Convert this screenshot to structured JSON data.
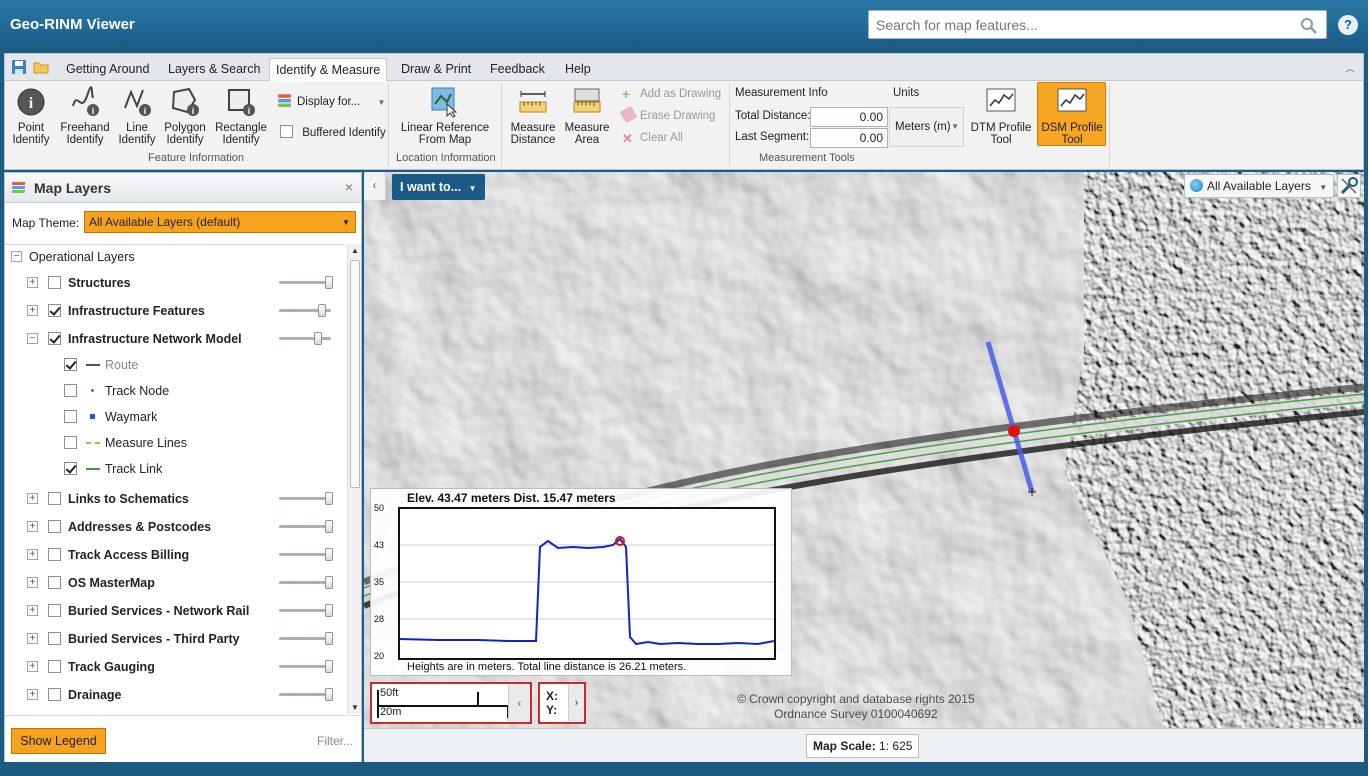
{
  "app": {
    "title": "Geo-RINM Viewer",
    "search_placeholder": "Search for map features...",
    "help_label": "?"
  },
  "ribbon": {
    "tabs": [
      "Getting Around",
      "Layers & Search",
      "Identify & Measure",
      "Draw & Print",
      "Feedback",
      "Help"
    ],
    "active_tab": "Identify & Measure",
    "feature_info": {
      "group_label": "Feature Information",
      "point_identify": "Point Identify",
      "freehand_identify": "Freehand Identify",
      "line_identify": "Line Identify",
      "polygon_identify": "Polygon Identify",
      "rectangle_identify": "Rectangle Identify",
      "display_for": "Display for...",
      "buffered_identify": "Buffered Identify"
    },
    "location_info": {
      "group_label": "Location Information",
      "linear_reference": "Linear Reference From Map"
    },
    "measurement": {
      "group_label": "Measurement Tools",
      "measure_distance": "Measure Distance",
      "measure_area": "Measure Area",
      "add_as_drawing": "Add as Drawing",
      "erase_drawing": "Erase Drawing",
      "clear_all": "Clear All",
      "info_header": "Measurement Info",
      "units_header": "Units",
      "total_distance_label": "Total Distance:",
      "total_distance_value": "0.00",
      "last_segment_label": "Last Segment:",
      "last_segment_value": "0.00",
      "units_value": "Meters (m)",
      "dtm_profile": "DTM Profile Tool",
      "dsm_profile": "DSM Profile Tool"
    }
  },
  "layers_panel": {
    "title": "Map Layers",
    "close_label": "×",
    "theme_label": "Map Theme:",
    "theme_value": "All Available Layers (default)",
    "root_label": "Operational Layers",
    "layers": [
      {
        "label": "Structures",
        "checked": false,
        "slider": 1.0
      },
      {
        "label": "Infrastructure Features",
        "checked": true,
        "slider": 0.85
      },
      {
        "label": "Infrastructure Network Model",
        "checked": true,
        "slider": 0.75,
        "expanded": true
      },
      {
        "label": "Links to Schematics",
        "checked": false,
        "slider": 1.0
      },
      {
        "label": "Addresses & Postcodes",
        "checked": false,
        "slider": 1.0
      },
      {
        "label": "Track Access Billing",
        "checked": false,
        "slider": 1.0
      },
      {
        "label": "OS MasterMap",
        "checked": false,
        "slider": 1.0
      },
      {
        "label": "Buried Services - Network Rail",
        "checked": false,
        "slider": 1.0
      },
      {
        "label": "Buried Services - Third Party",
        "checked": false,
        "slider": 1.0
      },
      {
        "label": "Track Gauging",
        "checked": false,
        "slider": 1.0
      },
      {
        "label": "Drainage",
        "checked": false,
        "slider": 1.0
      }
    ],
    "sublayers": [
      {
        "label": "Route",
        "checked": true,
        "symbol": "line",
        "color": "#555555",
        "muted": true
      },
      {
        "label": "Track Node",
        "checked": false,
        "symbol": "dot",
        "color": "#2e9b3a"
      },
      {
        "label": "Waymark",
        "checked": false,
        "symbol": "square",
        "color": "#2456d8"
      },
      {
        "label": "Measure Lines",
        "checked": false,
        "symbol": "dash",
        "color": "#e8a33a"
      },
      {
        "label": "Track Link",
        "checked": true,
        "symbol": "line",
        "color": "#3c9a3c"
      }
    ],
    "show_legend": "Show Legend",
    "filter": "Filter..."
  },
  "map": {
    "i_want_to": "I want to...",
    "layers_dropdown": "All Available Layers",
    "copyright_line1": "© Crown copyright and database rights 2015",
    "copyright_line2": "Ordnance Survey 0100040692",
    "scalebar_ft": "50ft",
    "scalebar_m": "20m",
    "x_label": "X:",
    "y_label": "Y:"
  },
  "profile": {
    "title": "Elev. 43.47 meters  Dist. 15.47 meters",
    "footer": "Heights are in meters.   Total line distance is 26.21 meters.",
    "y_ticks": [
      "50",
      "43",
      "35",
      "28",
      "20"
    ]
  },
  "status": {
    "scale_label": "Map Scale:",
    "scale_value": "1: 625"
  },
  "colors": {
    "accent": "#f7a21c",
    "header": "#1b5a84",
    "profile_line": "#1122cc",
    "marker": "#e01010"
  }
}
